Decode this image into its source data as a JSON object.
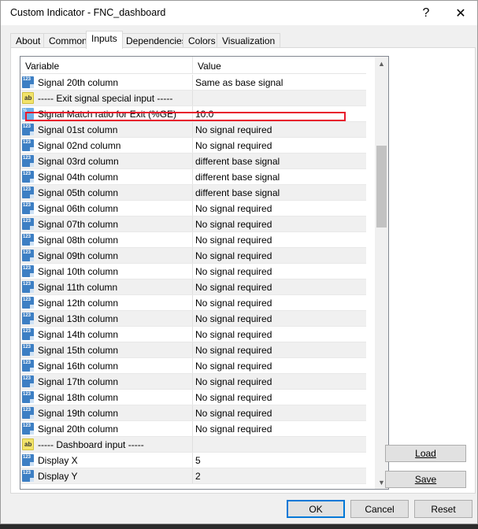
{
  "window": {
    "title": "Custom Indicator - FNC_dashboard",
    "help_glyph": "?",
    "close_glyph": "✕"
  },
  "tabs": [
    {
      "label": "About"
    },
    {
      "label": "Common"
    },
    {
      "label": "Inputs"
    },
    {
      "label": "Dependencies"
    },
    {
      "label": "Colors"
    },
    {
      "label": "Visualization"
    }
  ],
  "grid": {
    "col_variable": "Variable",
    "col_value": "Value",
    "rows": [
      {
        "type": "num",
        "variable": "Signal 20th column",
        "value": "Same as base signal"
      },
      {
        "type": "str",
        "variable": "----- Exit signal special input -----",
        "value": ""
      },
      {
        "type": "dbl",
        "variable": "Signal Match ratio for Exit (%GE)",
        "value": "10.0"
      },
      {
        "type": "num",
        "variable": "Signal 01st column",
        "value": "No signal required"
      },
      {
        "type": "num",
        "variable": "Signal 02nd column",
        "value": "No signal required"
      },
      {
        "type": "num",
        "variable": "Signal 03rd column",
        "value": "different base signal"
      },
      {
        "type": "num",
        "variable": "Signal 04th column",
        "value": "different base signal"
      },
      {
        "type": "num",
        "variable": "Signal 05th column",
        "value": "different base signal"
      },
      {
        "type": "num",
        "variable": "Signal 06th column",
        "value": "No signal required"
      },
      {
        "type": "num",
        "variable": "Signal 07th column",
        "value": "No signal required"
      },
      {
        "type": "num",
        "variable": "Signal 08th column",
        "value": "No signal required"
      },
      {
        "type": "num",
        "variable": "Signal 09th column",
        "value": "No signal required"
      },
      {
        "type": "num",
        "variable": "Signal 10th column",
        "value": "No signal required"
      },
      {
        "type": "num",
        "variable": "Signal 11th column",
        "value": "No signal required"
      },
      {
        "type": "num",
        "variable": "Signal 12th column",
        "value": "No signal required"
      },
      {
        "type": "num",
        "variable": "Signal 13th column",
        "value": "No signal required"
      },
      {
        "type": "num",
        "variable": "Signal 14th column",
        "value": "No signal required"
      },
      {
        "type": "num",
        "variable": "Signal 15th column",
        "value": "No signal required"
      },
      {
        "type": "num",
        "variable": "Signal 16th column",
        "value": "No signal required"
      },
      {
        "type": "num",
        "variable": "Signal 17th column",
        "value": "No signal required"
      },
      {
        "type": "num",
        "variable": "Signal 18th column",
        "value": "No signal required"
      },
      {
        "type": "num",
        "variable": "Signal 19th column",
        "value": "No signal required"
      },
      {
        "type": "num",
        "variable": "Signal 20th column",
        "value": "No signal required"
      },
      {
        "type": "str",
        "variable": "----- Dashboard input -----",
        "value": ""
      },
      {
        "type": "num",
        "variable": "Display X",
        "value": "5"
      },
      {
        "type": "num",
        "variable": "Display Y",
        "value": "2"
      }
    ]
  },
  "icons": {
    "num": "123",
    "str": "ab",
    "dbl": "½"
  },
  "side_buttons": {
    "load": "Load",
    "save": "Save"
  },
  "bottom_buttons": {
    "ok": "OK",
    "cancel": "Cancel",
    "reset": "Reset"
  },
  "scroll": {
    "up": "▲",
    "down": "▼"
  },
  "colors": {
    "highlight_box": "#e8192c",
    "default_button_border": "#0078d7"
  }
}
